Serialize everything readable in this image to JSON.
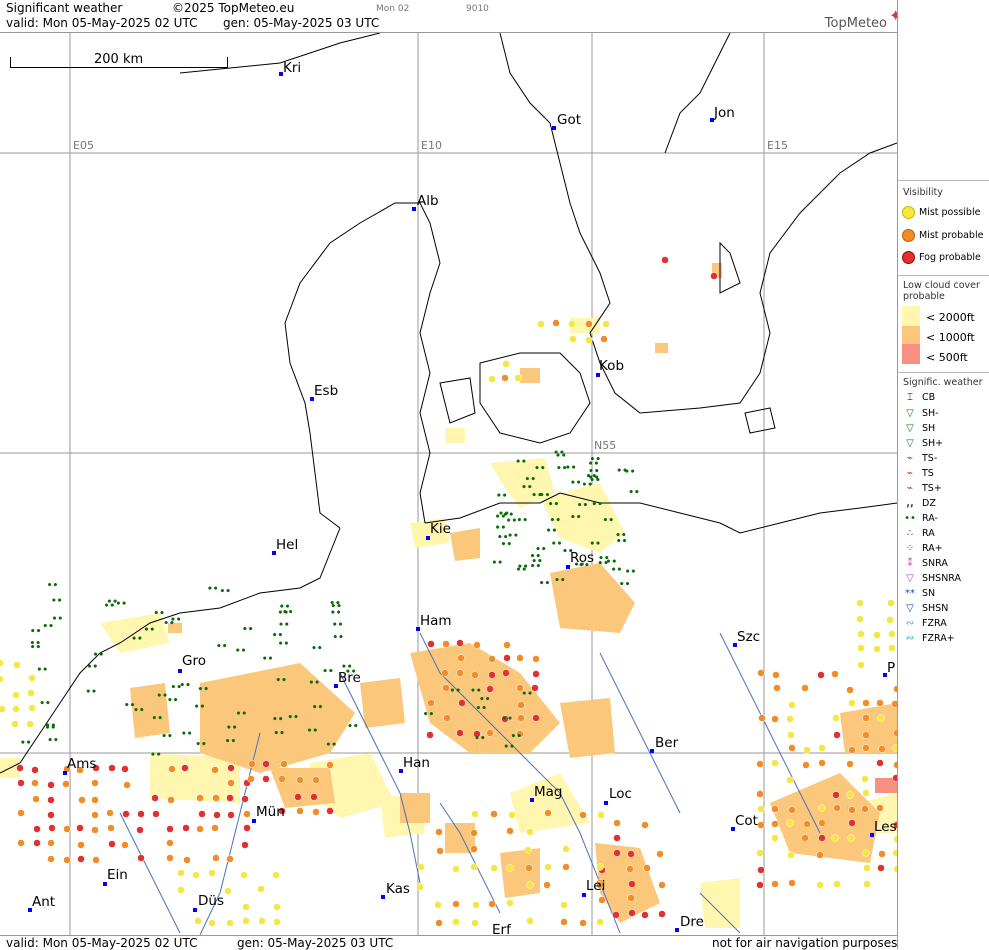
{
  "header": {
    "title": "Significant weather",
    "copyright": "©2025 TopMeteo.eu",
    "run": "Mon 02",
    "code": "9010",
    "valid": "valid:  Mon  05-May-2025  02 UTC",
    "gen": "gen: 05-May-2025 03 UTC",
    "logo": "TopMeteo"
  },
  "footer": {
    "valid": "valid:  Mon  05-May-2025  02 UTC",
    "gen": "gen: 05-May-2025 03 UTC",
    "disclaimer": "not for air navigation purposes"
  },
  "map": {
    "scale_label": "200 km",
    "grid_labels": {
      "e05": "E05",
      "e10": "E10",
      "e15": "E15",
      "n55": "N55"
    },
    "cities": {
      "kri": "Kri",
      "got": "Got",
      "jon": "Jon",
      "alb": "Alb",
      "kob": "Kob",
      "esb": "Esb",
      "kie": "Kie",
      "ros": "Ros",
      "hel": "Hel",
      "ham": "Ham",
      "szc": "Szc",
      "gro": "Gro",
      "bre": "Bre",
      "ber": "Ber",
      "ams": "Ams",
      "han": "Han",
      "mag": "Mag",
      "loc": "Loc",
      "mun": "Mün",
      "cot": "Cot",
      "les": "Les",
      "ein": "Ein",
      "kas": "Kas",
      "lei": "Lei",
      "ant": "Ant",
      "dus": "Düs",
      "dre": "Dre",
      "erf": "Erf",
      "p": "P"
    }
  },
  "legend": {
    "visibility": {
      "title": "Visibility",
      "mist_possible": "Mist possible",
      "mist_probable": "Mist probable",
      "fog_probable": "Fog probable"
    },
    "low_cloud": {
      "title": "Low cloud cover probable",
      "lt2000": "< 2000ft",
      "lt1000": "< 1000ft",
      "lt500": "<   500ft"
    },
    "sigwx": {
      "title": "Signific. weather",
      "cb": "CB",
      "sh_minus": "SH-",
      "sh": "SH",
      "sh_plus": "SH+",
      "ts_minus": "TS-",
      "ts": "TS",
      "ts_plus": "TS+",
      "dz": "DZ",
      "ra_minus": "RA-",
      "ra": "RA",
      "ra_plus": "RA+",
      "snra": "SNRA",
      "shsnra": "SHSNRA",
      "sn": "SN",
      "shsn": "SHSN",
      "fzra": "FZRA",
      "fzra_plus": "FZRA+"
    },
    "colors": {
      "mist_possible": "#f5e642",
      "mist_probable": "#f28c28",
      "fog_probable": "#e03030",
      "lc_2000": "#fff6b0",
      "lc_1000": "#fbc77a",
      "lc_500": "#f79080",
      "rain": "#0a6b0a"
    }
  }
}
